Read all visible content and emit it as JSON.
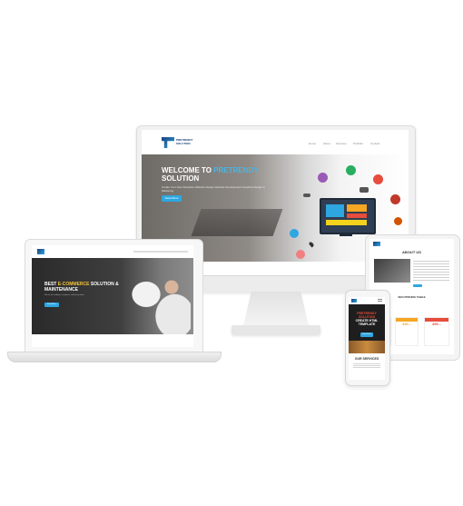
{
  "desktop": {
    "logo_text": "PRETRENDY SOLUTION",
    "nav": [
      "Home",
      "About",
      "Services",
      "Portfolio",
      "Contact"
    ],
    "hero_title_1": "WELCOME TO ",
    "hero_title_accent": "PRETRENDY",
    "hero_title_2": "SOLUTION",
    "hero_sub": "Create Your Own Attractive Website Design Website Development Graphics Design & Marketing",
    "hero_button": "Read More"
  },
  "laptop": {
    "hero_title_1": "BEST ",
    "hero_title_accent": "E-COMMERCE",
    "hero_title_2": " SOLUTION & MAINTENANCE",
    "hero_sub": "We are the leading e-commerce solution provider",
    "hero_button": "Read More"
  },
  "tablet": {
    "about_heading": "ABOUT US",
    "pricing_heading": "SEO PRICING TABLE",
    "prices": [
      "?",
      "349...",
      "499..."
    ]
  },
  "phone": {
    "hero_title_1": "PRETRENDY",
    "hero_title_2": "SOLUTION",
    "hero_title_3": "CREATE HTML",
    "hero_title_4": "TEMPLATE",
    "button": "Read More",
    "services_heading": "OUR SERVICES"
  },
  "colors": {
    "accent": "#2ea7e0",
    "orange": "#f5a623",
    "red": "#e74c3c",
    "purple": "#9b59b6"
  },
  "icons": [
    "chat-icon",
    "pencil-icon",
    "car-icon",
    "group-icon",
    "gear-icon",
    "laptop-icon",
    "location-icon",
    "user-icon"
  ]
}
